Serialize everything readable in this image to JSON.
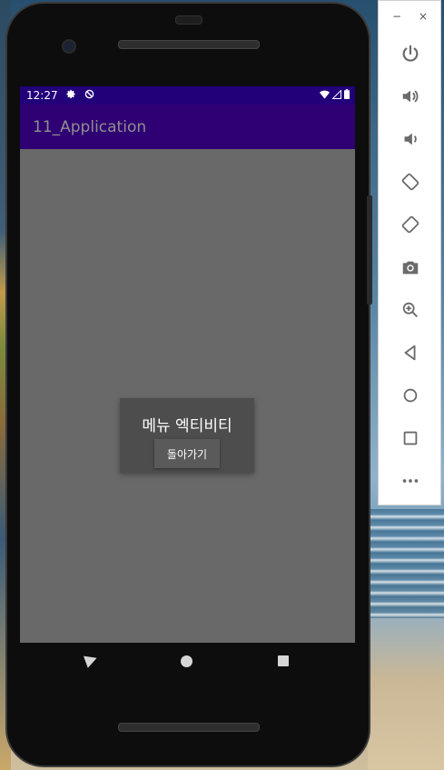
{
  "status_bar": {
    "time": "12:27"
  },
  "app": {
    "title": "11_Application"
  },
  "dialog": {
    "title": "메뉴 엑티비티",
    "button_label": "돌아가기"
  },
  "emulator_toolbar": {
    "minimize": "−",
    "close": "×",
    "buttons": [
      {
        "icon": "power-icon"
      },
      {
        "icon": "volume-up-icon"
      },
      {
        "icon": "volume-down-icon"
      },
      {
        "icon": "rotate-left-icon"
      },
      {
        "icon": "rotate-right-icon"
      },
      {
        "icon": "camera-icon"
      },
      {
        "icon": "zoom-icon"
      },
      {
        "icon": "back-icon"
      },
      {
        "icon": "home-icon"
      },
      {
        "icon": "overview-icon"
      },
      {
        "icon": "more-icon"
      }
    ]
  },
  "colors": {
    "status_bar": "#22007a",
    "app_bar": "#2f0073",
    "content": "#696969",
    "dialog": "#4d4d4d"
  }
}
